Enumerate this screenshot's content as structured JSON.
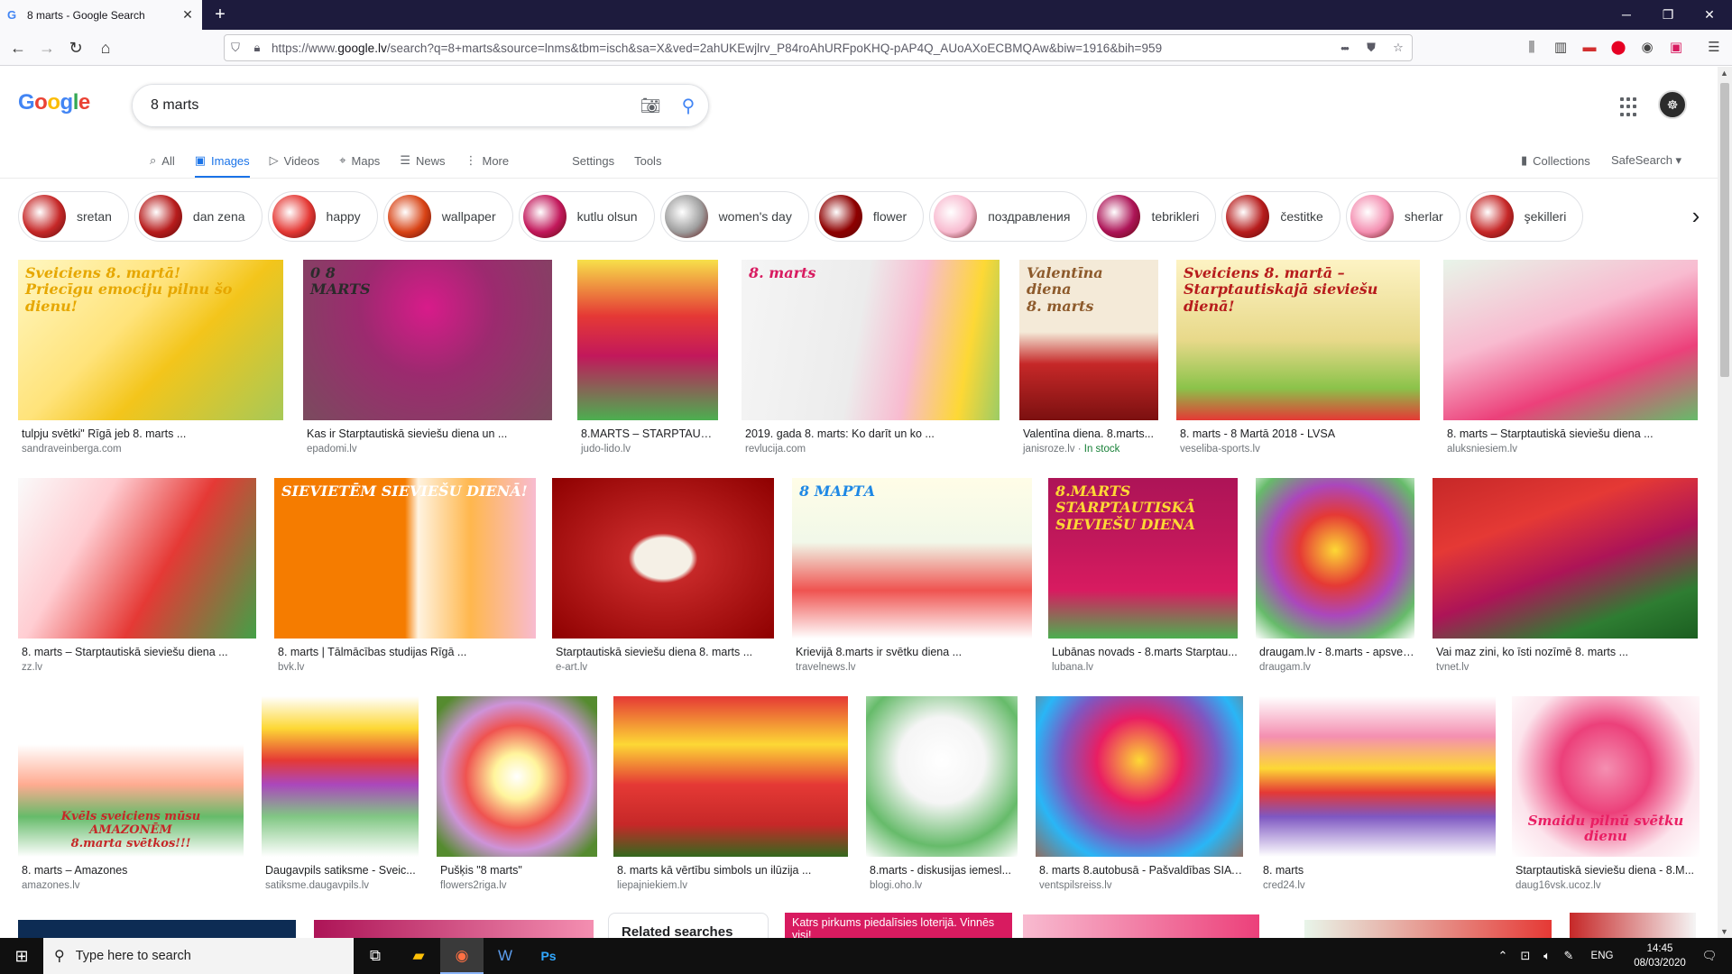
{
  "browser": {
    "tab_title": "8 marts - Google Search",
    "url_prefix": "https://www.",
    "url_domain": "google.lv",
    "url_rest": "/search?q=8+marts&source=lnms&tbm=isch&sa=X&ved=2ahUKEwjlrv_P84roAhURFpoKHQ-pAP4Q_AUoAXoECBMQAw&biw=1916&bih=959",
    "url_more": "•••"
  },
  "search": {
    "logo_letters": [
      "G",
      "o",
      "o",
      "g",
      "l",
      "e"
    ],
    "logo_colors": [
      "#4285f4",
      "#ea4335",
      "#fbbc05",
      "#4285f4",
      "#34a853",
      "#ea4335"
    ],
    "query": "8 marts"
  },
  "tabs": [
    {
      "icon": "⌕",
      "label": "All"
    },
    {
      "icon": "▣",
      "label": "Images"
    },
    {
      "icon": "▷",
      "label": "Videos"
    },
    {
      "icon": "⌖",
      "label": "Maps"
    },
    {
      "icon": "☰",
      "label": "News"
    },
    {
      "icon": "⋮",
      "label": "More"
    },
    {
      "icon": "",
      "label": "Settings"
    },
    {
      "icon": "",
      "label": "Tools"
    }
  ],
  "right_links": {
    "collections": "Collections",
    "safesearch": "SafeSearch ▾"
  },
  "chips": [
    {
      "label": "sretan",
      "color": "#c62828"
    },
    {
      "label": "dan zena",
      "color": "#b71c1c"
    },
    {
      "label": "happy",
      "color": "#e53935"
    },
    {
      "label": "wallpaper",
      "color": "#d84315"
    },
    {
      "label": "kutlu olsun",
      "color": "#c2185b"
    },
    {
      "label": "women's day",
      "color": "#9e9e9e"
    },
    {
      "label": "flower",
      "color": "#8e0000"
    },
    {
      "label": "поздравления",
      "color": "#f8bbd0"
    },
    {
      "label": "tebrikleri",
      "color": "#ad1457"
    },
    {
      "label": "čestitke",
      "color": "#b71c1c"
    },
    {
      "label": "sherlar",
      "color": "#f48fb1"
    },
    {
      "label": "şekilleri",
      "color": "#c62828"
    }
  ],
  "results": [
    [
      {
        "cap": "tulpju svētki\" Rīgā jeb 8. marts ...",
        "src": "sandraveinberga.com",
        "bg": "linear-gradient(135deg,#fff7c2 0%,#ffe37a 40%,#f3c51b 60%,#a7c957 100%)",
        "ovl": "Sveiciens 8. martā!\nPriecīgu emociju pilnu šo dienu!",
        "ovlColor": "#e6a700"
      },
      {
        "cap": "Kas ir Starptautiskā sieviešu diena un ...",
        "src": "epadomi.lv",
        "bg": "radial-gradient(circle at 50% 30%,#d81b8a 0%,#9c2a6f 40%,#7a4b5e 100%)",
        "ovl": "0 8\nMARTS",
        "ovlColor": "#2b2b2b"
      },
      {
        "cap": "8.MARTS – STARPTAUTIS...",
        "src": "judo-lido.lv",
        "bg": "linear-gradient(180deg,#f7e04a 0%,#e53935 35%,#c2185b 60%,#4caf50 100%)",
        "ovl": "",
        "ovlColor": "#fff"
      },
      {
        "cap": "2019. gada 8. marts: Ko darīt un ko ...",
        "src": "revlucija.com",
        "bg": "linear-gradient(100deg,#f5f5f5 0%,#ececec 45%,#f8bbd0 65%,#fdd835 85%,#9ccc65 100%)",
        "ovl": "8. marts",
        "ovlColor": "#d81b60"
      },
      {
        "cap": "Valentīna diena. 8.marts...",
        "src": "janisroze.lv",
        "stock": "In stock",
        "bg": "linear-gradient(180deg,#f4ead8 0%,#f4ead8 45%,#c62828 65%,#7b1010 100%)",
        "ovl": "Valentīna diena\n8. marts",
        "ovlColor": "#8d5a2b"
      },
      {
        "cap": "8. marts - 8 Martā 2018 - LVSA",
        "src": "veseliba-sports.lv",
        "bg": "linear-gradient(180deg,#fdf3c4 0%,#e8d98a 50%,#8bc34a 80%,#e53935 100%)",
        "ovl": "Sveiciens 8. martā –\nStarptautiskajā sieviešu dienā!",
        "ovlColor": "#b71c1c"
      },
      {
        "cap": "8. marts – Starptautiskā sieviešu diena ...",
        "src": "aluksniesiem.lv",
        "bg": "linear-gradient(160deg,#e8f5e9 0%,#f8bbd0 40%,#ec407a 70%,#66bb6a 100%)",
        "ovl": "",
        "ovlColor": "#fff"
      }
    ],
    [
      {
        "cap": "8. marts – Starptautiskā sieviešu diena ...",
        "src": "zz.lv",
        "bg": "linear-gradient(120deg,#fafafa 0%,#ffcdd2 30%,#e53935 60%,#43a047 100%)",
        "ovl": "",
        "ovlColor": "#fff"
      },
      {
        "cap": "8. marts | Tālmācības studijas Rīgā ...",
        "src": "bvk.lv",
        "bg": "linear-gradient(90deg,#f57c00 0%,#f57c00 50%,#fff3e0 55%,#ffb74d 75%,#f8bbd0 100%)",
        "ovl": "SIEVIETĒM SIEVIEŠU DIENĀ!",
        "ovlColor": "#ffffff"
      },
      {
        "cap": "Starptautiskā sieviešu diena 8. marts ...",
        "src": "e-art.lv",
        "bg": "radial-gradient(ellipse at 50% 50%,#f5f0e6 0%,#f5f0e6 18%,#c62828 22%,#8e0000 100%)",
        "ovl": "",
        "ovlColor": "#fff"
      },
      {
        "cap": "Krievijā 8.marts ir svētku diena ...",
        "src": "travelnews.lv",
        "bg": "linear-gradient(180deg,#fffde7 0%,#f1f8e9 40%,#ef5350 70%,#fff 100%)",
        "ovl": "8 МАРТА",
        "ovlColor": "#1e88e5"
      },
      {
        "cap": "Lubānas novads - 8.marts Starptau...",
        "src": "lubana.lv",
        "bg": "linear-gradient(180deg,#ad1457 0%,#c2185b 40%,#d81b60 70%,#4caf50 100%)",
        "ovl": "8.MARTS\nSTARPTAUTISKĀ\nSIEVIEŠU DIENA",
        "ovlColor": "#fdd835"
      },
      {
        "cap": "draugam.lv - 8.marts - apsvei...",
        "src": "draugam.lv",
        "bg": "radial-gradient(circle at 50% 45%,#fdd835 0%,#e53935 30%,#ab47bc 55%,#66bb6a 80%,#fff 100%)",
        "ovl": "",
        "ovlColor": "#fff"
      },
      {
        "cap": "Vai maz zini, ko īsti nozīmē 8. marts ...",
        "src": "tvnet.lv",
        "bg": "linear-gradient(160deg,#c62828 0%,#e53935 30%,#ad1457 55%,#2e7d32 80%,#1b5e20 100%)",
        "ovl": "",
        "ovlColor": "#fff"
      }
    ],
    [
      {
        "cap": "8. marts – Amazones",
        "src": "amazones.lv",
        "bg": "linear-gradient(180deg,#ffffff 0%,#fff 30%,#ffab91 55%,#66bb6a 75%,#fff 100%)",
        "ovl": "",
        "ovlColor": "#c62828"
      },
      {
        "cap": "Daugavpils satiksme - Sveic...",
        "src": "satiksme.daugavpils.lv",
        "bg": "linear-gradient(180deg,#fff 0%,#fdd835 20%,#e53935 40%,#ab47bc 55%,#81c784 75%,#fff 100%)",
        "ovl": "",
        "ovlColor": "#c62828"
      },
      {
        "cap": "Pušķis \"8 marts\"",
        "src": "flowers2riga.lv",
        "bg": "radial-gradient(circle at 50% 50%,#fff 0%,#fff59d 20%,#ef5350 45%,#ce93d8 65%,#558b2f 90%)",
        "ovl": "",
        "ovlColor": "#fff"
      },
      {
        "cap": "8. marts kā vērtību simbols un ilūzija ...",
        "src": "liepajniekiem.lv",
        "bg": "linear-gradient(180deg,#e53935 0%,#fdd835 30%,#e53935 55%,#c62828 80%,#33691e 100%)",
        "ovl": "",
        "ovlColor": "#fff"
      },
      {
        "cap": "8.marts - diskusijas iemesl...",
        "src": "blogi.oho.lv",
        "bg": "radial-gradient(circle at 50% 40%,#ffffff 0%,#f5f5f5 35%,#66bb6a 70%,#fff 100%)",
        "ovl": "",
        "ovlColor": "#fff"
      },
      {
        "cap": "8. marts 8.autobusā - Pašvaldības SIA ...",
        "src": "ventspilsreiss.lv",
        "bg": "radial-gradient(circle at 50% 40%,#fdd835 0%,#e91e63 30%,#7e57c2 55%,#29b6f6 75%,#8d6e63 100%)",
        "ovl": "",
        "ovlColor": "#fff"
      },
      {
        "cap": "8. marts",
        "src": "cred24.lv",
        "bg": "linear-gradient(180deg,#fff 0%,#f48fb1 25%,#fdd835 45%,#e53935 60%,#7e57c2 75%,#fff 100%)",
        "ovl": "",
        "ovlColor": "#fff"
      },
      {
        "cap": "Starptautiskā sieviešu diena - 8.M...",
        "src": "daug16vsk.ucoz.lv",
        "bg": "radial-gradient(circle at 50% 45%,#f48fb1 0%,#ec407a 35%,#fce4ec 70%,#ffffff 100%)",
        "ovl": "",
        "ovlColor": "#e91e63"
      }
    ]
  ],
  "overlays_extra": {
    "amazones": "Kvēls sveiciens mūsu AMAZONĒM\n8.marta svētkos!!!",
    "daug16": "Smaidu pilnū svētku dienu"
  },
  "bottom_row": {
    "related": "Related searches",
    "lottery": "Katrs pirkums piedalīsies loterijā. Vinnēs visi!"
  },
  "taskbar": {
    "search_placeholder": "Type here to search",
    "lang": "ENG",
    "time": "14:45",
    "date": "08/03/2020"
  }
}
